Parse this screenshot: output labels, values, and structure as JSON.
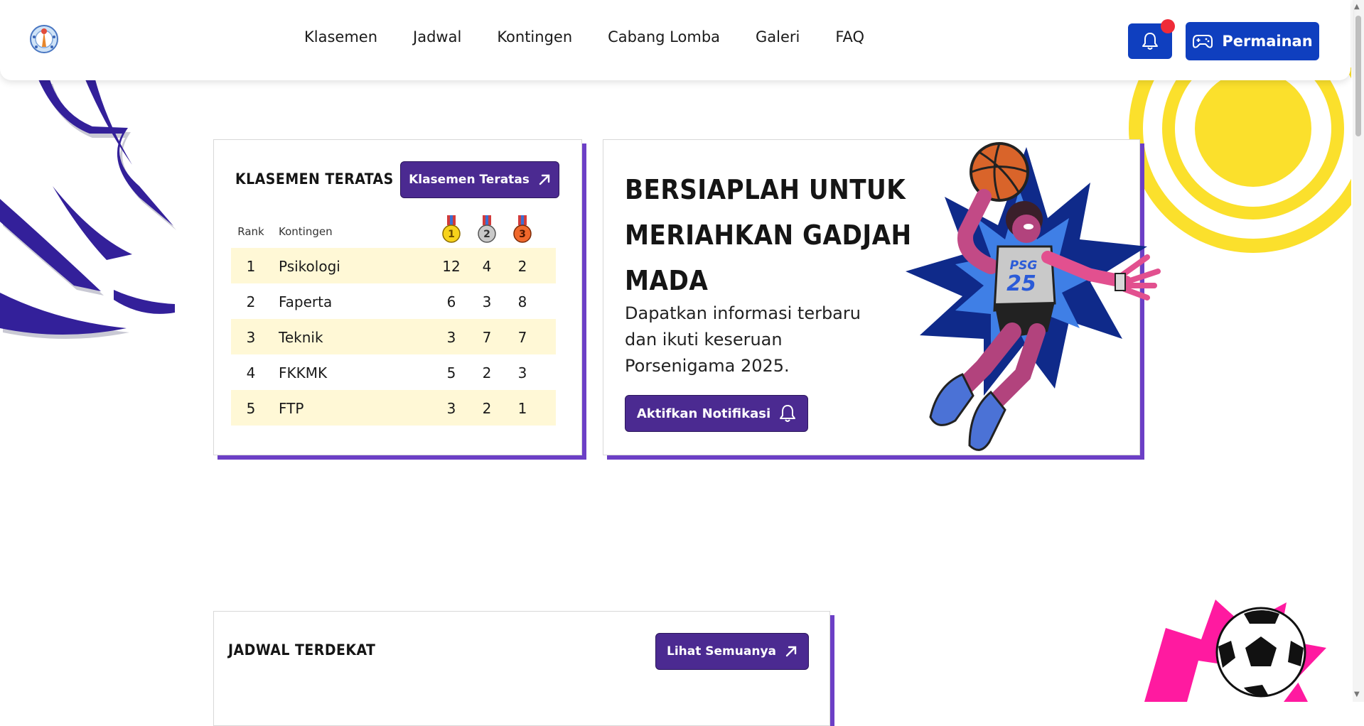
{
  "nav": {
    "logo_icon": "porsenigama-logo-icon",
    "links": [
      "Klasemen",
      "Jadwal",
      "Kontingen",
      "Cabang Lomba",
      "Galeri",
      "FAQ"
    ],
    "notification_icon": "bell-icon",
    "play_button": {
      "icon": "gamepad-icon",
      "label": "Permainan"
    }
  },
  "colors": {
    "primary_blue": "#0f3fbf",
    "accent_purple": "#4b2a91",
    "card_shadow_purple": "#6c3fc6",
    "row_highlight": "#fff8d6",
    "notification_dot": "#ef2b38",
    "yellow_deco": "#fbe02c"
  },
  "standings": {
    "title": "Klasemen Teratas",
    "button_label": "Klasemen Teratas",
    "button_icon": "arrow-up-right-icon",
    "headers": {
      "rank": "Rank",
      "team": "Kontingen",
      "gold": "1",
      "silver": "2",
      "bronze": "3"
    },
    "rows": [
      {
        "rank": "1",
        "team": "Psikologi",
        "gold": "12",
        "silver": "4",
        "bronze": "2"
      },
      {
        "rank": "2",
        "team": "Faperta",
        "gold": "6",
        "silver": "3",
        "bronze": "8"
      },
      {
        "rank": "3",
        "team": "Teknik",
        "gold": "3",
        "silver": "7",
        "bronze": "7"
      },
      {
        "rank": "4",
        "team": "FKKMK",
        "gold": "5",
        "silver": "2",
        "bronze": "3"
      },
      {
        "rank": "5",
        "team": "FTP",
        "gold": "3",
        "silver": "2",
        "bronze": "1"
      }
    ]
  },
  "hero": {
    "title_lines": [
      "Bersiaplah untuk",
      "meriahkan Gadjah",
      "Mada"
    ],
    "subtitle": "Dapatkan informasi terbaru dan ikuti keseruan Porsenigama 2025.",
    "button_label": "Aktifkan Notifikasi",
    "button_icon": "bell-icon",
    "jersey_text": "PSG",
    "jersey_number": "25"
  },
  "schedule": {
    "title": "Jadwal Terdekat",
    "button_label": "Lihat Semuanya",
    "button_icon": "arrow-up-right-icon"
  }
}
